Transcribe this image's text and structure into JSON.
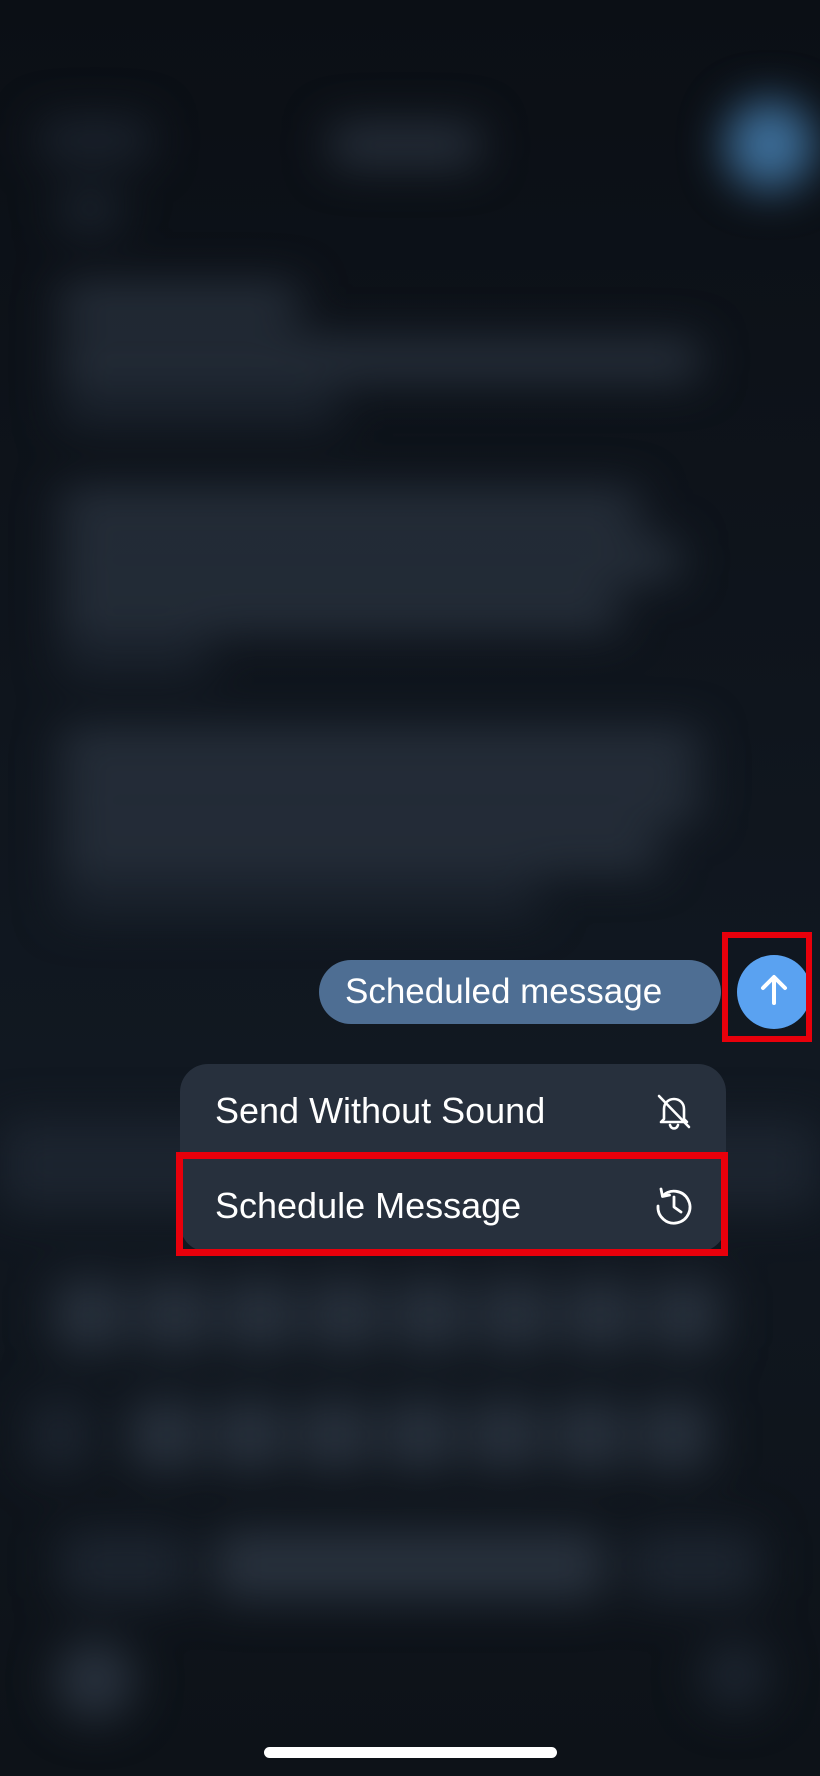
{
  "composer": {
    "draft_text": "Scheduled message"
  },
  "send_button": {
    "icon": "arrow-up-icon",
    "color": "#5aa2f1"
  },
  "context_menu": {
    "items": [
      {
        "label": "Send Without Sound",
        "icon": "bell-slash-icon"
      },
      {
        "label": "Schedule Message",
        "icon": "clock-history-icon"
      }
    ]
  },
  "highlight_color": "#e8000b"
}
